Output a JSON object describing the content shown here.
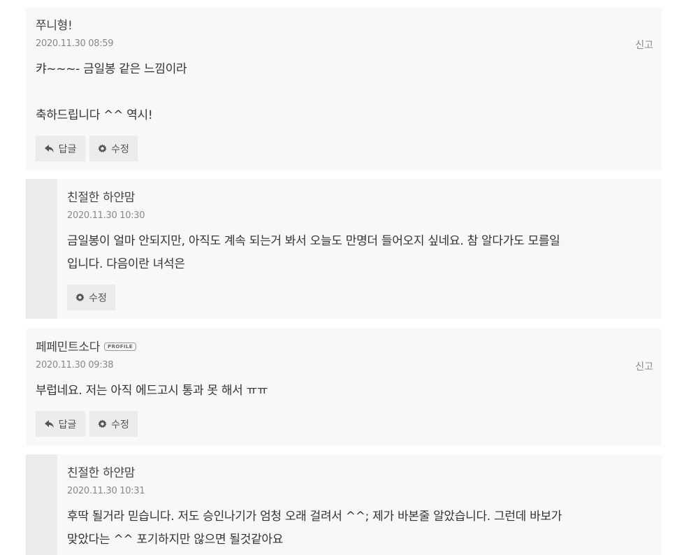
{
  "comments": [
    {
      "author": "쭈니형!",
      "date": "2020.11.30 08:59",
      "report": "신고",
      "line1": "캬~~~- 금일봉 같은 느낌이라",
      "line2": "축하드립니다 ^^ 역시!",
      "reply_btn": "답글",
      "edit_btn": "수정"
    },
    {
      "author": "친절한 하얀맘",
      "date": "2020.11.30 10:30",
      "line1": "금일봉이 얼마 안되지만, 아직도 계속 되는거 봐서 오늘도 만명더 들어오지 싶네요. 참 알다가도 모를일",
      "line2": "입니다. 다음이란 녀석은",
      "edit_btn": "수정"
    },
    {
      "author": "페페민트소다",
      "badge": "PROFILE",
      "date": "2020.11.30 09:38",
      "report": "신고",
      "line1": "부럽네요. 저는 아직 에드고시 통과 못 해서 ㅠㅠ",
      "reply_btn": "답글",
      "edit_btn": "수정"
    },
    {
      "author": "친절한 하얀맘",
      "date": "2020.11.30 10:31",
      "line1": "후딱 될거라 믿습니다. 저도 승인나기가 엄청 오래 걸려서 ^^; 제가 바본줄 알았습니다. 그런데 바보가",
      "line2": "맞았다는 ^^ 포기하지만 않으면 될것같아요"
    }
  ],
  "icons": {
    "reply": "reply-arrow-icon",
    "edit": "gear-icon"
  }
}
